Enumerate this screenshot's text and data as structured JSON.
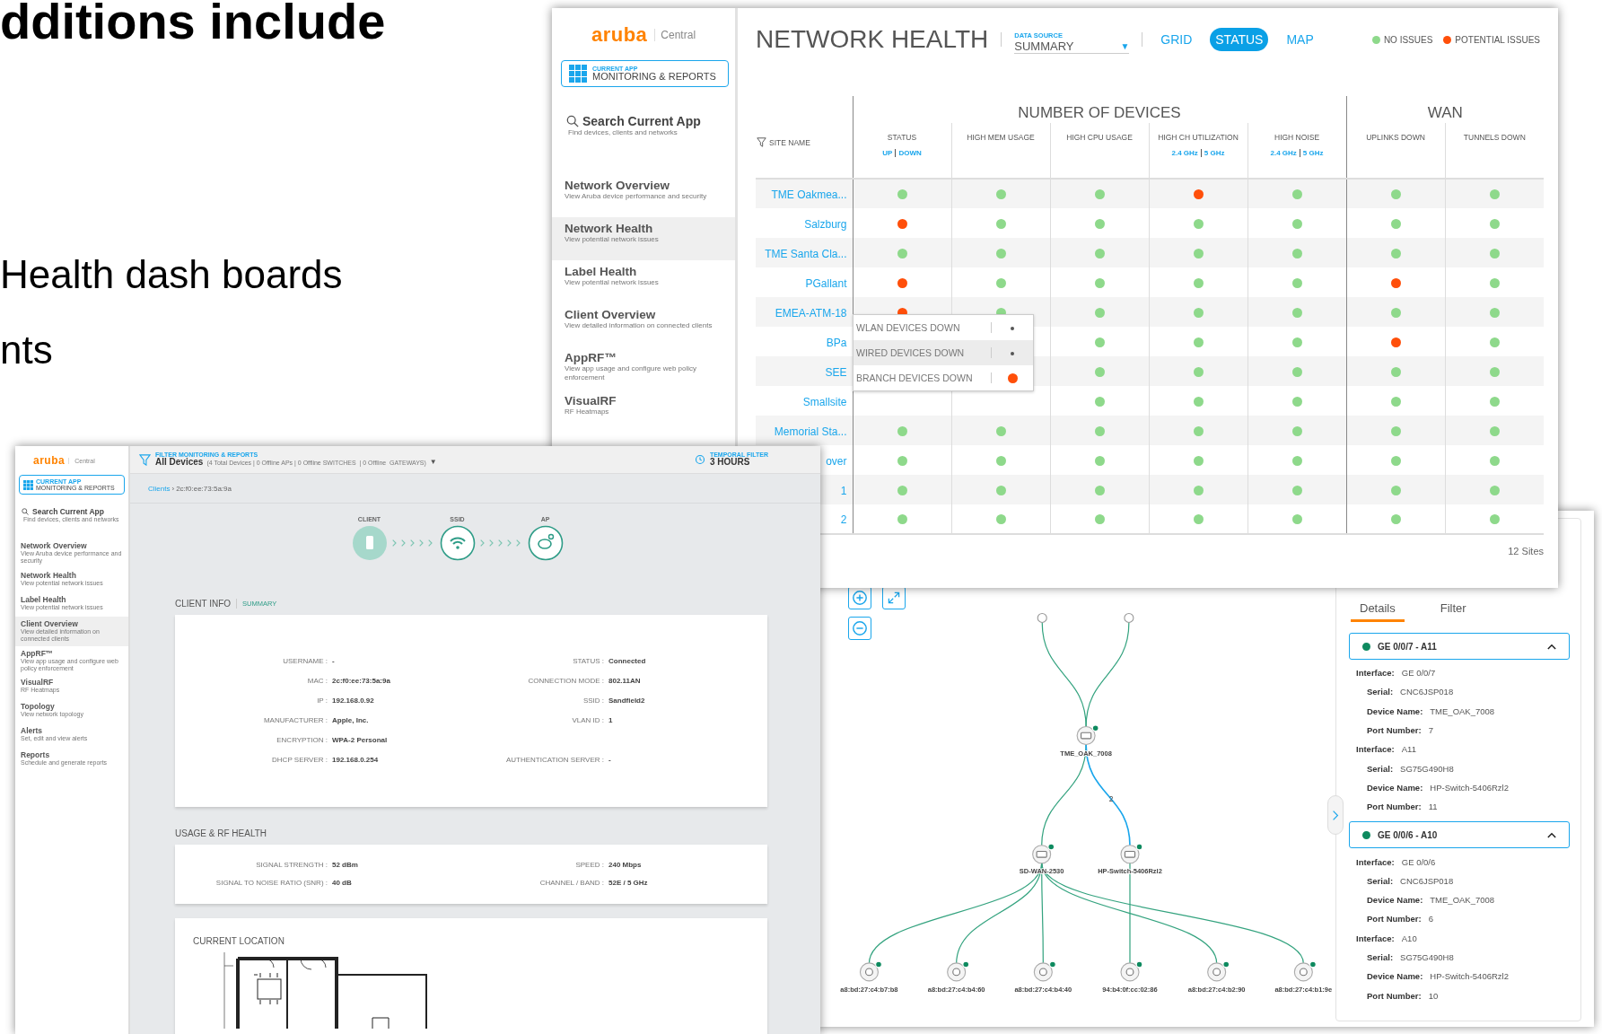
{
  "slide": {
    "heading": "dditions include",
    "bullets": [
      "Health dash boards",
      "nts"
    ]
  },
  "health_window": {
    "sidebar": {
      "logo": "aruba",
      "product": "Central",
      "current_app": {
        "label": "CURRENT APP",
        "value": "MONITORING & REPORTS"
      },
      "search": {
        "title": "Search Current App",
        "hint": "Find devices, clients and networks"
      },
      "items": [
        {
          "title": "Network Overview",
          "subtitle": "View Aruba device performance and security",
          "selected": false
        },
        {
          "title": "Network Health",
          "subtitle": "View potential network issues",
          "selected": true
        },
        {
          "title": "Label Health",
          "subtitle": "View potential network issues",
          "selected": false
        },
        {
          "title": "Client Overview",
          "subtitle": "View detailed information on connected clients",
          "selected": false
        },
        {
          "title": "AppRF™",
          "subtitle": "View app usage and configure web policy enforcement",
          "selected": false
        },
        {
          "title": "VisualRF",
          "subtitle": "RF Heatmaps",
          "selected": false
        }
      ]
    },
    "title": "NETWORK HEALTH",
    "data_source": {
      "label": "DATA SOURCE",
      "value": "SUMMARY",
      "caret": "▼"
    },
    "views": [
      {
        "label": "GRID",
        "selected": false
      },
      {
        "label": "STATUS",
        "selected": true
      },
      {
        "label": "MAP",
        "selected": false
      }
    ],
    "legend": [
      {
        "label": "NO ISSUES",
        "color": "#8ed98b"
      },
      {
        "label": "POTENTIAL ISSUES",
        "color": "#ff4f0a"
      }
    ],
    "table": {
      "site_column": "SITE NAME",
      "groups": [
        {
          "label": "NUMBER OF DEVICES",
          "columns": [
            {
              "label": "STATUS",
              "bands": [
                "UP",
                "DOWN"
              ]
            },
            {
              "label": "HIGH MEM USAGE"
            },
            {
              "label": "HIGH CPU USAGE"
            },
            {
              "label": "HIGH CH UTILIZATION",
              "bands": [
                "2.4 GHz",
                "5 GHz"
              ]
            },
            {
              "label": "HIGH NOISE",
              "bands": [
                "2.4 GHz",
                "5 GHz"
              ]
            }
          ]
        },
        {
          "label": "WAN",
          "columns": [
            {
              "label": "UPLINKS DOWN"
            },
            {
              "label": "TUNNELS DOWN"
            }
          ]
        }
      ],
      "rows": [
        {
          "site": "TME Oakmea...",
          "issues": [
            false,
            false,
            false,
            true,
            false,
            false,
            false
          ]
        },
        {
          "site": "Salzburg",
          "issues": [
            true,
            false,
            false,
            false,
            false,
            false,
            false
          ]
        },
        {
          "site": "TME Santa Cla...",
          "issues": [
            false,
            false,
            false,
            false,
            false,
            false,
            false
          ]
        },
        {
          "site": "PGallant",
          "issues": [
            true,
            false,
            false,
            false,
            false,
            true,
            false
          ]
        },
        {
          "site": "EMEA-ATM-18",
          "issues": [
            true,
            false,
            false,
            false,
            false,
            false,
            false
          ]
        },
        {
          "site": "BPa",
          "issues": [
            false,
            false,
            false,
            true,
            false
          ]
        },
        {
          "site": "SEE",
          "issues": [
            false,
            false,
            false,
            false,
            false
          ]
        },
        {
          "site": "Smallsite",
          "issues": [
            false,
            false,
            false,
            false,
            false
          ]
        },
        {
          "site": "Memorial Sta...",
          "issues": [
            false,
            false,
            false,
            false,
            false,
            false,
            false
          ]
        },
        {
          "site": "over",
          "issues": [
            false,
            false,
            false,
            false,
            false,
            false,
            false
          ]
        },
        {
          "site": "1",
          "issues": [
            false,
            false,
            false,
            false,
            false,
            false,
            false
          ]
        },
        {
          "site": "2",
          "issues": [
            false,
            false,
            false,
            false,
            false,
            false,
            false
          ]
        }
      ],
      "footer": "12 Sites"
    },
    "tooltip": [
      {
        "label": "WLAN DEVICES DOWN",
        "issue": false,
        "highlighted": false
      },
      {
        "label": "WIRED DEVICES DOWN",
        "issue": false,
        "highlighted": true
      },
      {
        "label": "BRANCH DEVICES DOWN",
        "issue": true,
        "highlighted": false
      }
    ]
  },
  "client_window": {
    "sidebar": {
      "logo": "aruba",
      "product": "Central",
      "current_app": {
        "label": "CURRENT APP",
        "value": "MONITORING & REPORTS"
      },
      "search": {
        "title": "Search Current App",
        "hint": "Find devices, clients and networks"
      },
      "items": [
        {
          "title": "Network Overview",
          "subtitle": "View Aruba device performance and security",
          "selected": false
        },
        {
          "title": "Network Health",
          "subtitle": "View potential network issues",
          "selected": false
        },
        {
          "title": "Label Health",
          "subtitle": "View potential network issues",
          "selected": false
        },
        {
          "title": "Client Overview",
          "subtitle": "View detailed information on connected clients",
          "selected": true
        },
        {
          "title": "AppRF™",
          "subtitle": "View app usage and configure web policy enforcement",
          "selected": false
        },
        {
          "title": "VisualRF",
          "subtitle": "RF Heatmaps",
          "selected": false
        },
        {
          "title": "Topology",
          "subtitle": "View network topology",
          "selected": false
        },
        {
          "title": "Alerts",
          "subtitle": "Set, edit and view alerts",
          "selected": false
        },
        {
          "title": "Reports",
          "subtitle": "Schedule and generate reports",
          "selected": false
        }
      ]
    },
    "filter": {
      "label": "FILTER MONITORING & REPORTS",
      "value": "All Devices",
      "detail": "(4 Total Devices | 0 Offline APs | 0 Offline SWITCHES  | 0 Offline  GATEWAYS)",
      "caret": "▼"
    },
    "temporal_filter": {
      "label": "TEMPORAL FILTER",
      "value": "3 HOURS"
    },
    "breadcrumb": {
      "link": "Clients",
      "separator": "›",
      "current": "2c:f0:ee:73:5a:9a"
    },
    "path": [
      {
        "label": "CLIENT",
        "kind": "client"
      },
      {
        "label": "SSID",
        "kind": "ssid"
      },
      {
        "label": "AP",
        "kind": "ap"
      }
    ],
    "client_info": {
      "title": "CLIENT INFO",
      "tab": "SUMMARY",
      "rows": [
        {
          "left": {
            "label": "USERNAME :",
            "value": "-"
          },
          "right": {
            "label": "STATUS :",
            "value": "Connected"
          }
        },
        {
          "left": {
            "label": "MAC :",
            "value": "2c:f0:ee:73:5a:9a"
          },
          "right": {
            "label": "CONNECTION MODE :",
            "value": "802.11AN"
          }
        },
        {
          "left": {
            "label": "IP :",
            "value": "192.168.0.92"
          },
          "right": {
            "label": "SSID :",
            "value": "Sandfield2"
          }
        },
        {
          "left": {
            "label": "MANUFACTURER :",
            "value": "Apple, Inc."
          },
          "right": {
            "label": "VLAN ID :",
            "value": "1"
          }
        },
        {
          "left": {
            "label": "ENCRYPTION :",
            "value": "WPA-2 Personal"
          }
        },
        {
          "left": {
            "label": "DHCP SERVER :",
            "value": "192.168.0.254"
          },
          "right": {
            "label": "AUTHENTICATION SERVER :",
            "value": "-"
          }
        }
      ]
    },
    "usage": {
      "title": "USAGE & RF HEALTH",
      "rows": [
        {
          "left": {
            "label": "SIGNAL STRENGTH :",
            "value": "52 dBm"
          },
          "right": {
            "label": "SPEED :",
            "value": "240 Mbps"
          }
        },
        {
          "left": {
            "label": "SIGNAL TO NOISE RATIO (SNR) :",
            "value": "40 dB"
          },
          "right": {
            "label": "CHANNEL / BAND :",
            "value": "52E / 5 GHz"
          }
        }
      ]
    },
    "location": {
      "title": "CURRENT LOCATION"
    }
  },
  "topology_window": {
    "gateway": {
      "label": "TME_OAK_7008",
      "switches": [
        {
          "label": "SD-WAN-2530",
          "highlighted": false,
          "aps": [
            {
              "label": "a8:bd:27:c4:b7:b8"
            },
            {
              "label": "a8:bd:27:c4:b4:60"
            },
            {
              "label": "a8:bd:27:c4:b4:40"
            },
            {
              "label": "a8:bd:27:c4:b2:90"
            },
            {
              "label": "a8:bd:27:c4:b1:9e"
            }
          ]
        },
        {
          "label": "HP-Switch-5406Rzl2",
          "highlighted": true,
          "link_label": "2",
          "aps": [
            {
              "label": "94:b4:0f:cc:02:86"
            }
          ]
        }
      ]
    },
    "tabs": [
      {
        "label": "Details",
        "selected": true
      },
      {
        "label": "Filter",
        "selected": false
      }
    ],
    "sections": [
      {
        "title": "GE 0/0/7 - A11",
        "expanded": true,
        "interfaces": [
          {
            "label": "Interface:",
            "value": "GE 0/0/7",
            "fields": [
              {
                "label": "Serial:",
                "value": "CNC6JSP018"
              },
              {
                "label": "Device Name:",
                "value": "TME_OAK_7008"
              },
              {
                "label": "Port Number:",
                "value": "7"
              }
            ]
          },
          {
            "label": "Interface:",
            "value": "A11",
            "fields": [
              {
                "label": "Serial:",
                "value": "SG75G490H8"
              },
              {
                "label": "Device Name:",
                "value": "HP-Switch-5406Rzl2"
              },
              {
                "label": "Port Number:",
                "value": "11"
              }
            ]
          }
        ]
      },
      {
        "title": "GE 0/0/6 - A10",
        "expanded": true,
        "interfaces": [
          {
            "label": "Interface:",
            "value": "GE 0/0/6",
            "fields": [
              {
                "label": "Serial:",
                "value": "CNC6JSP018"
              },
              {
                "label": "Device Name:",
                "value": "TME_OAK_7008"
              },
              {
                "label": "Port Number:",
                "value": "6"
              }
            ]
          },
          {
            "label": "Interface:",
            "value": "A10",
            "fields": [
              {
                "label": "Serial:",
                "value": "SG75G490H8"
              },
              {
                "label": "Device Name:",
                "value": "HP-Switch-5406Rzl2"
              },
              {
                "label": "Port Number:",
                "value": "10"
              }
            ]
          }
        ]
      }
    ]
  }
}
